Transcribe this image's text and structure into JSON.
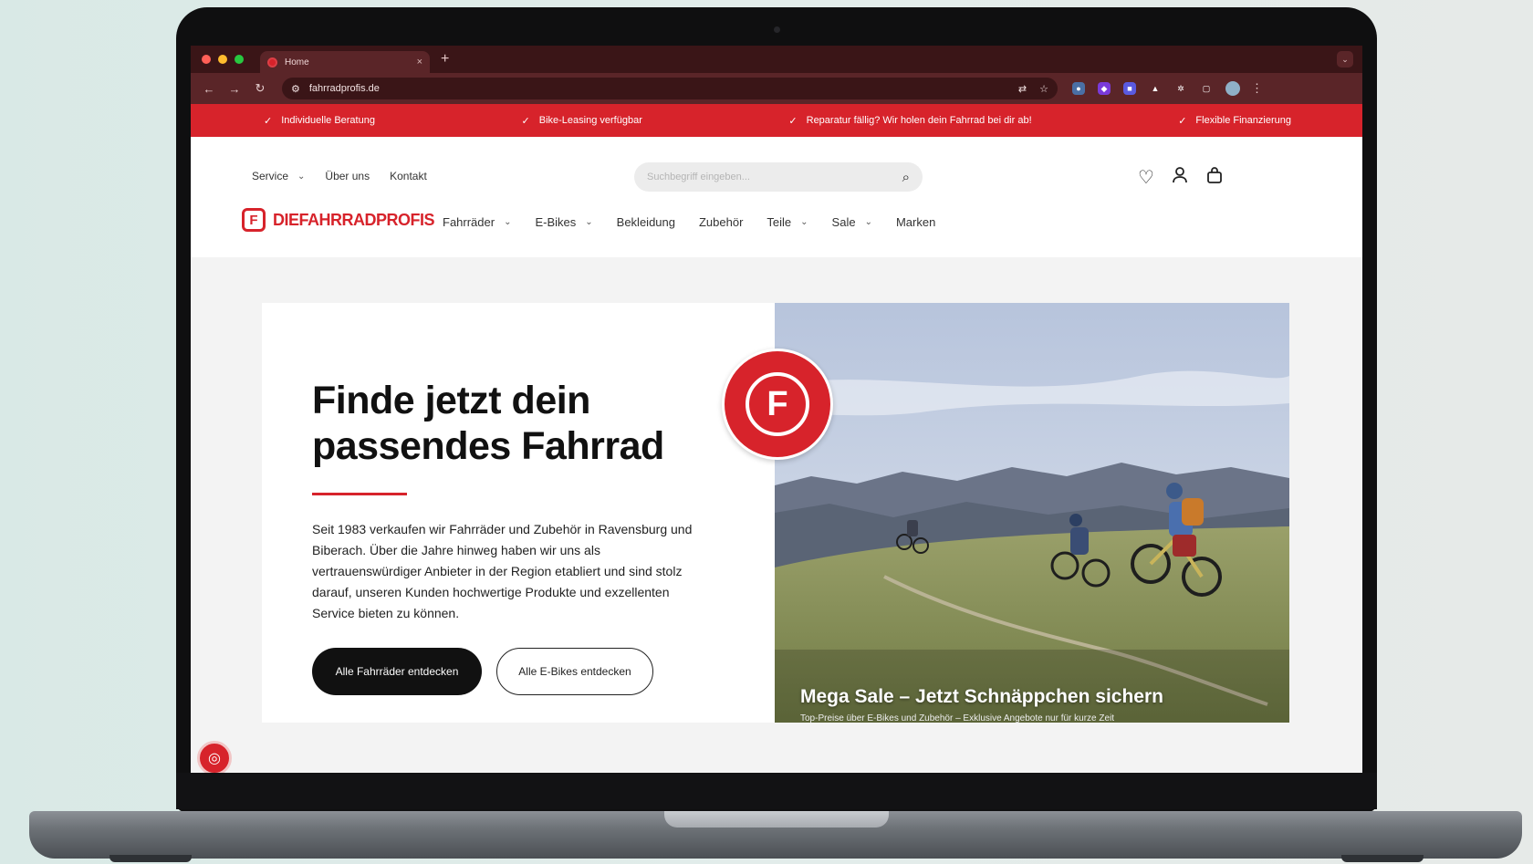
{
  "browser": {
    "tab_title": "Home",
    "tab_close": "×",
    "new_tab": "+",
    "url": "fahrradprofis.de",
    "back": "←",
    "forward": "→",
    "reload": "↻"
  },
  "promo": {
    "items": [
      "Individuelle Beratung",
      "Bike-Leasing verfügbar",
      "Reparatur fällig? Wir holen dein Fahrrad bei dir ab!",
      "Flexible Finanzierung"
    ]
  },
  "header": {
    "top_links": [
      "Service",
      "Über uns",
      "Kontakt"
    ],
    "search_placeholder": "Suchbegriff eingeben...",
    "logo_text": "DIEFAHRRADPROFIS",
    "nav": [
      {
        "label": "Fahrräder",
        "has_dropdown": true
      },
      {
        "label": "E-Bikes",
        "has_dropdown": true
      },
      {
        "label": "Bekleidung",
        "has_dropdown": false
      },
      {
        "label": "Zubehör",
        "has_dropdown": false
      },
      {
        "label": "Teile",
        "has_dropdown": true
      },
      {
        "label": "Sale",
        "has_dropdown": true
      },
      {
        "label": "Marken",
        "has_dropdown": false
      }
    ]
  },
  "hero": {
    "title_line1": "Finde jetzt dein",
    "title_line2": "passendes Fahrrad",
    "body": "Seit 1983 verkaufen wir Fahrräder und Zubehör in Ravensburg und Biberach. Über die Jahre hinweg haben wir uns als vertrauenswürdiger Anbieter in der Region etabliert und sind stolz darauf, unseren Kunden hochwertige Produkte und exzellenten Service bieten zu können.",
    "cta_primary": "Alle Fahrräder entdecken",
    "cta_secondary": "Alle E-Bikes entdecken",
    "image_caption": "Mega Sale – Jetzt Schnäppchen sichern",
    "image_subcaption": "Top-Preise über E-Bikes und Zubehör – Exklusive Angebote nur für kurze Zeit",
    "badge_letter": "F"
  },
  "colors": {
    "brand_red": "#d7232b",
    "chrome_dark": "#3a1517",
    "chrome_mid": "#5a2528"
  }
}
